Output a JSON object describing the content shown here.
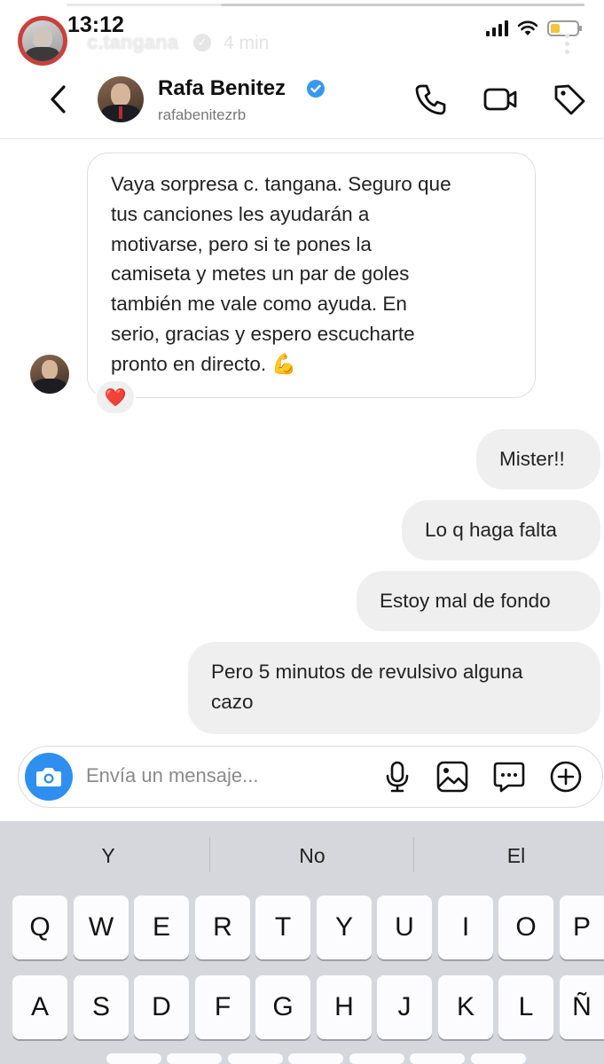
{
  "story": {
    "time": "13:12",
    "username": "c.tangana",
    "posted_ago": "4 min",
    "battery_color": "#f3c53a"
  },
  "header": {
    "name": "Rafa Benitez",
    "handle": "rafabenitezrb",
    "icons": [
      "back-chevron-icon",
      "phone-icon",
      "video-camera-icon",
      "tag-icon"
    ],
    "verified_color": "#3897f0"
  },
  "messages": {
    "incoming_text": "Vaya sorpresa c. tangana.  Seguro que\ntus canciones les ayudarán a\nmotivarse, pero si te pones la\ncamiseta y metes un par de goles\ntambién me vale como ayuda. En\nserio, gracias y espero escucharte\npronto en directo. 💪",
    "reaction": "❤️",
    "outgoing": [
      "Mister!!",
      "Lo q haga falta",
      "Estoy mal de fondo",
      "Pero 5 minutos de revulsivo alguna\ncazo"
    ]
  },
  "composer": {
    "placeholder": "Envía un mensaje...",
    "icons": [
      "camera-icon",
      "microphone-icon",
      "gallery-icon",
      "sticker-icon",
      "plus-icon"
    ]
  },
  "keyboard": {
    "suggestions": [
      "Y",
      "No",
      "El"
    ],
    "row1": [
      "Q",
      "W",
      "E",
      "R",
      "T",
      "Y",
      "U",
      "I",
      "O",
      "P"
    ],
    "row2": [
      "A",
      "S",
      "D",
      "F",
      "G",
      "H",
      "J",
      "K",
      "L",
      "Ñ"
    ]
  }
}
